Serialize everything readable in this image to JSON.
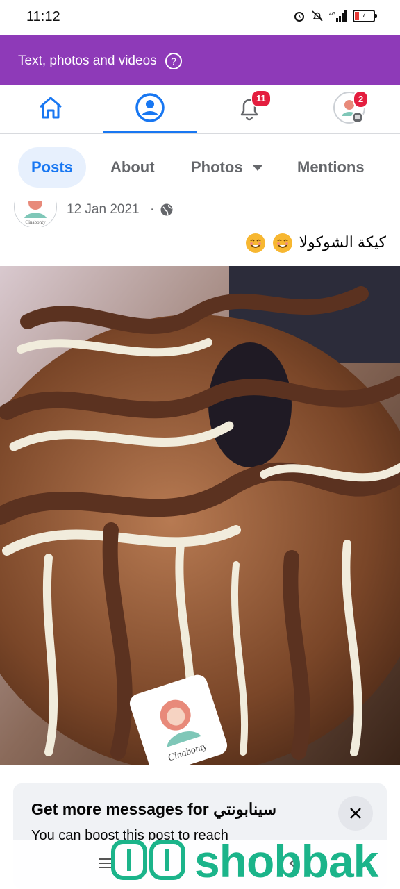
{
  "status_bar": {
    "time": "11:12",
    "battery_level": "7",
    "icons": [
      "alarm-icon",
      "muted-bell-icon",
      "4g-signal-icon",
      "battery-icon"
    ]
  },
  "banner": {
    "text": "Text, photos and videos",
    "help_symbol": "?"
  },
  "top_nav": {
    "items": [
      {
        "name": "home",
        "icon": "home-icon"
      },
      {
        "name": "profile",
        "icon": "profile-icon",
        "active": true
      },
      {
        "name": "notifications",
        "icon": "bell-icon",
        "badge": "11"
      },
      {
        "name": "menu",
        "icon": "menu-avatar-icon",
        "badge": "2"
      }
    ]
  },
  "tabs": {
    "posts": "Posts",
    "about": "About",
    "photos": "Photos",
    "mentions": "Mentions"
  },
  "post": {
    "date": "12 Jan 2021",
    "separator": "·",
    "caption": "كيكة الشوكولا",
    "photo_watermark": "Cinabonty"
  },
  "card": {
    "title": "Get more messages for سينابونتي",
    "body": "You can boost this post to reach"
  },
  "watermark": {
    "text": "shobbak"
  },
  "colors": {
    "banner": "#8e3ab8",
    "accent": "#1877f2",
    "badge": "#e41e3f",
    "watermark": "#1bb48a"
  }
}
